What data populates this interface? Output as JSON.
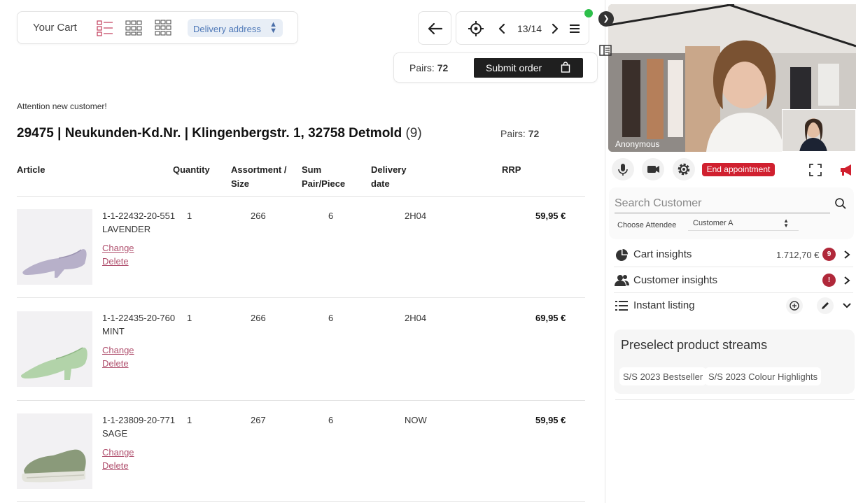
{
  "header": {
    "cart_title": "Your Cart",
    "delivery_select": "Delivery address",
    "page_indicator": "13/14"
  },
  "order": {
    "pairs_label": "Pairs:",
    "pairs_value": "72",
    "submit_label": "Submit order"
  },
  "customer": {
    "attention": "Attention new customer!",
    "line": "29475 | Neukunden-Kd.Nr. | Klingenbergstr. 1, 32758 Detmold",
    "count": "(9)",
    "pairs_label": "Pairs:",
    "pairs_value": "72"
  },
  "table": {
    "headers": {
      "article": "Article",
      "quantity": "Quantity",
      "assortment_1": "Assortment /",
      "assortment_2": "Size",
      "sum_1": "Sum",
      "sum_2": "Pair/Piece",
      "delivery_1": "Delivery",
      "delivery_2": "date",
      "rrp": "RRP"
    },
    "rows": [
      {
        "article_no": "1-1-22432-20-551",
        "color": "LAVENDER",
        "quantity": "1",
        "assortment": "266",
        "sum": "6",
        "delivery": "2H04",
        "rrp": "59,95 €",
        "change": "Change",
        "delete": "Delete"
      },
      {
        "article_no": "1-1-22435-20-760",
        "color": "MINT",
        "quantity": "1",
        "assortment": "266",
        "sum": "6",
        "delivery": "2H04",
        "rrp": "69,95 €",
        "change": "Change",
        "delete": "Delete"
      },
      {
        "article_no": "1-1-23809-20-771",
        "color": "SAGE",
        "quantity": "1",
        "assortment": "267",
        "sum": "6",
        "delivery": "NOW",
        "rrp": "59,95 €",
        "change": "Change",
        "delete": "Delete"
      }
    ]
  },
  "video": {
    "participant_name": "Anonymous",
    "end_label": "End appointment"
  },
  "customer_panel": {
    "search_placeholder": "Search Customer",
    "attendee_label": "Choose Attendee",
    "attendee_value": "Customer A"
  },
  "insights": {
    "cart_label": "Cart insights",
    "cart_value": "1.712,70 €",
    "cart_badge": "9",
    "customer_label": "Customer insights",
    "customer_badge": "!",
    "listing_label": "Instant listing"
  },
  "streams": {
    "title": "Preselect product streams",
    "chips": [
      "S/S 2023 Bestseller",
      "S/S 2023 Colour Highlights"
    ]
  },
  "colors": {
    "accent_link": "#b0506e",
    "end_button": "#d0202f",
    "badge": "#b0283a",
    "online_dot": "#2dbf4a"
  },
  "icons": {
    "view_list": "list-view-icon",
    "view_grid_2": "grid-2-icon",
    "view_grid_3": "grid-3-icon",
    "back": "arrow-left-icon",
    "locate": "crosshair-icon",
    "prev": "chevron-left-icon",
    "next": "chevron-right-icon",
    "menu": "hamburger-icon",
    "bag": "shopping-bag-icon",
    "mic": "microphone-icon",
    "camera": "camera-icon",
    "settings": "gear-icon",
    "fullscreen": "fullscreen-icon",
    "announce": "megaphone-icon",
    "search": "search-icon",
    "pie": "pie-chart-icon",
    "users": "users-icon",
    "list": "list-icon"
  }
}
